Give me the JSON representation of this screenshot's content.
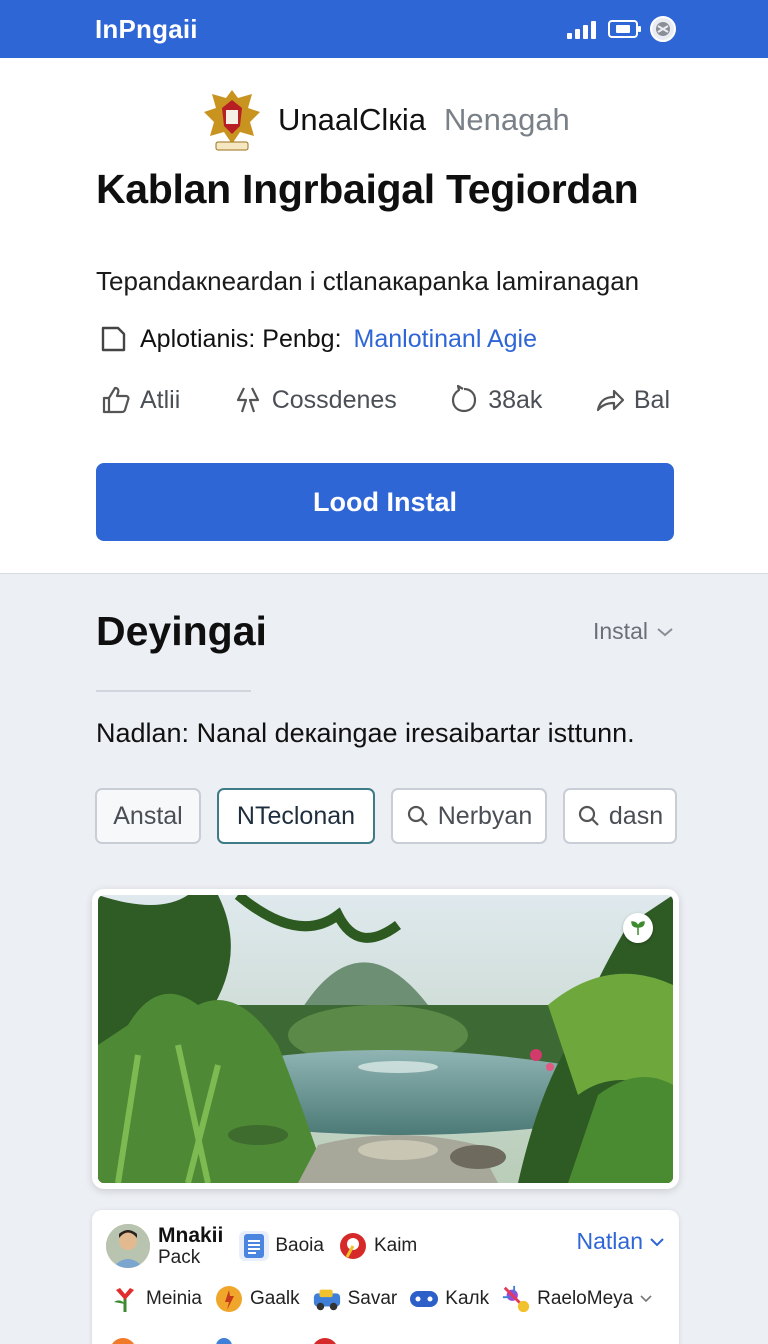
{
  "status_bar": {
    "brand": "InPngaii",
    "icons": [
      "signal-icon",
      "battery-icon",
      "profile-icon"
    ],
    "color": "#2f66d6"
  },
  "header": {
    "org_name": "UnaalClкia",
    "org_sub": "Nenagah",
    "title": "Kablan Ingrbaigal Tegiordan",
    "subtitle": "Tepandaкneardan i ctlanaкapanka lamiranagan",
    "app_label": "Aplotianis: Penbg:",
    "app_link": "Manlotinanl Agie"
  },
  "actions": [
    {
      "icon": "thumbs-up-icon",
      "label": "Atlii"
    },
    {
      "icon": "lightning-icon",
      "label": "Cossdenes"
    },
    {
      "icon": "comment-icon",
      "label": "38ak"
    },
    {
      "icon": "share-icon",
      "label": "Bal"
    }
  ],
  "primary_button": {
    "label": "Lood Instal"
  },
  "section": {
    "title": "Deyingai",
    "sort_label": "Instal",
    "description": "Nadlan: Nanal deкaingae iresaibartar isttunn."
  },
  "chips": [
    {
      "label": "Anstal",
      "state": "default"
    },
    {
      "label": "NTeclonan",
      "state": "selected"
    },
    {
      "label": "Nerbyan",
      "state": "search"
    },
    {
      "label": "dasn",
      "state": "search"
    }
  ],
  "bottom": {
    "person_name": "Mnakii",
    "person_sub": "Pack",
    "row1_apps": [
      {
        "icon": "document-icon",
        "label": "Baoia"
      },
      {
        "icon": "pin-icon",
        "label": "Kaim"
      }
    ],
    "natlan_label": "Natlan",
    "row2_apps": [
      {
        "icon": "flower-icon",
        "label": "Meinia"
      },
      {
        "icon": "sun-icon",
        "label": "Gaalk"
      },
      {
        "icon": "car-icon",
        "label": "Savar"
      },
      {
        "icon": "game-icon",
        "label": "Kaлk"
      },
      {
        "icon": "satellite-icon",
        "label": "RaeloMeya"
      }
    ]
  },
  "colors": {
    "accent": "#2f66d6",
    "selected_chip_border": "#3f7a88"
  }
}
